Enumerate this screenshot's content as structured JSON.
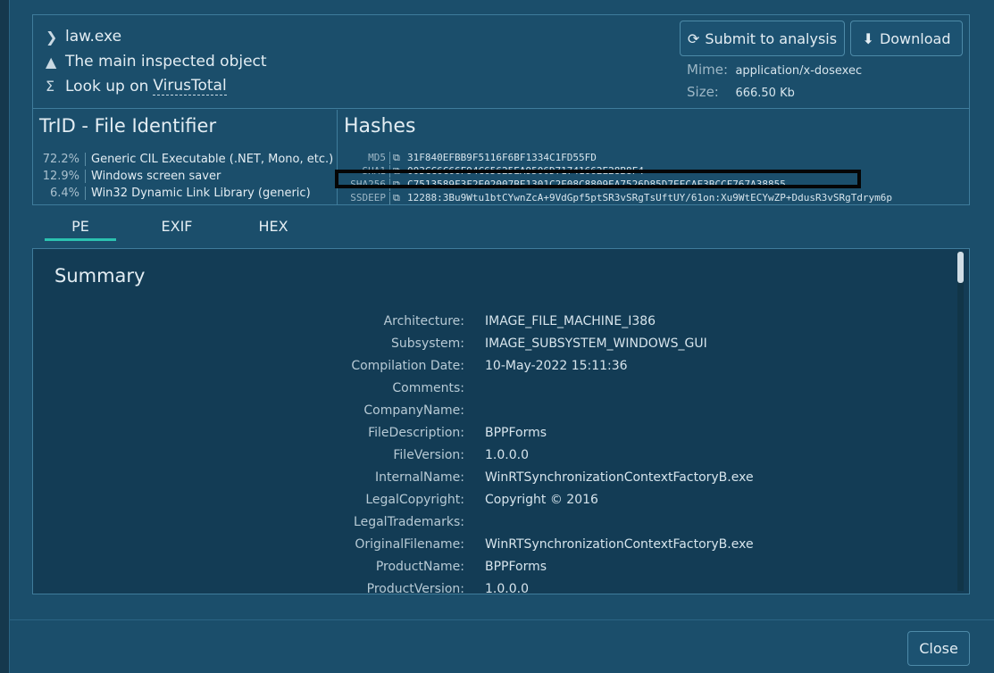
{
  "file": {
    "name": "law.exe",
    "role": "The main inspected object",
    "lookup_prefix": "Look up on",
    "lookup_link": "VirusTotal"
  },
  "actions": {
    "submit_label": "Submit to analysis",
    "download_label": "Download"
  },
  "meta": {
    "mime_label": "Mime:",
    "mime_value": "application/x-dosexec",
    "size_label": "Size:",
    "size_value": "666.50 Kb"
  },
  "trid": {
    "title": "TrID - File Identifier",
    "items": [
      {
        "pct": "72.2%",
        "desc": "Generic CIL Executable (.NET, Mono, etc.)"
      },
      {
        "pct": "12.9%",
        "desc": "Windows screen saver"
      },
      {
        "pct": "6.4%",
        "desc": "Win32 Dynamic Link Library (generic)"
      }
    ]
  },
  "hashes": {
    "title": "Hashes",
    "items": [
      {
        "type": "MD5",
        "value": "31F840EFBB9F5116F6BF1334C1FD55FD"
      },
      {
        "type": "SHA1",
        "value": "003CC6C66F94C65625EA9506D71741662E28B8F4"
      },
      {
        "type": "SHA256",
        "value": "C7513589F3F2E02007BE1301C2F08C8809EA7526D85D7EFCAF3BCCF767A38855"
      },
      {
        "type": "SSDEEP",
        "value": "12288:3Bu9Wtu1btCYwnZcA+9VdGpf5ptSR3vSRgTsUftUY/61on:Xu9WtECYwZP+DdusR3vSRgTdrym6p"
      }
    ]
  },
  "tabs": [
    {
      "label": "PE",
      "active": true
    },
    {
      "label": "EXIF",
      "active": false
    },
    {
      "label": "HEX",
      "active": false
    }
  ],
  "summary": {
    "title": "Summary",
    "rows": [
      {
        "key": "Architecture:",
        "value": "IMAGE_FILE_MACHINE_I386"
      },
      {
        "key": "Subsystem:",
        "value": "IMAGE_SUBSYSTEM_WINDOWS_GUI"
      },
      {
        "key": "Compilation Date:",
        "value": "10-May-2022 15:11:36"
      },
      {
        "key": "Comments:",
        "value": ""
      },
      {
        "key": "CompanyName:",
        "value": ""
      },
      {
        "key": "FileDescription:",
        "value": "BPPForms"
      },
      {
        "key": "FileVersion:",
        "value": "1.0.0.0"
      },
      {
        "key": "InternalName:",
        "value": "WinRTSynchronizationContextFactoryB.exe"
      },
      {
        "key": "LegalCopyright:",
        "value": "Copyright © 2016"
      },
      {
        "key": "LegalTrademarks:",
        "value": ""
      },
      {
        "key": "OriginalFilename:",
        "value": "WinRTSynchronizationContextFactoryB.exe"
      },
      {
        "key": "ProductName:",
        "value": "BPPForms"
      },
      {
        "key": "ProductVersion:",
        "value": "1.0.0.0"
      }
    ]
  },
  "footer": {
    "close_label": "Close"
  },
  "icons": {
    "chevron": "chevron-right-icon",
    "warning": "warning-icon",
    "sigma": "sigma-icon",
    "refresh": "refresh-icon",
    "download": "download-arrow-icon",
    "copy": "copy-icon"
  },
  "colors": {
    "background": "#1b4e6b",
    "panel": "#133c55",
    "border": "#3f7c9b",
    "accent": "#2bc2b0"
  }
}
